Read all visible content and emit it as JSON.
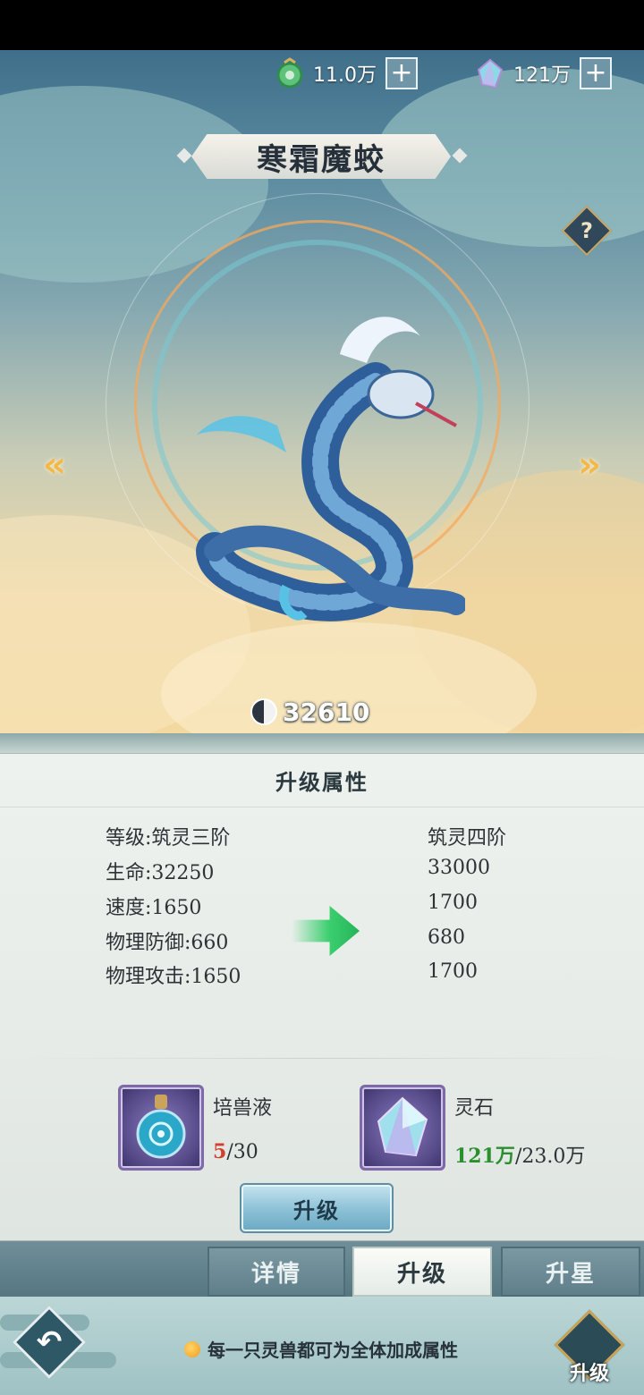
{
  "header": {
    "currencies": [
      {
        "icon": "jade-coin-icon",
        "value": "11.0万"
      },
      {
        "icon": "spirit-crystal-icon",
        "value": "121万"
      }
    ],
    "beast_name": "寒霜魔蛟",
    "help": "?",
    "nav_prev": "«",
    "nav_next": "»",
    "power": "32610"
  },
  "panel": {
    "title": "升级属性",
    "stats": [
      {
        "current": "等级:筑灵三阶",
        "next": "筑灵四阶"
      },
      {
        "current": "生命:32250",
        "next": "33000"
      },
      {
        "current": "速度:1650",
        "next": "1700"
      },
      {
        "current": "物理防御:660",
        "next": "680"
      },
      {
        "current": "物理攻击:1650",
        "next": "1700"
      }
    ],
    "materials": [
      {
        "name": "培兽液",
        "have": "5",
        "need": "/30",
        "icon": "potion-bottle-icon"
      },
      {
        "name": "灵石",
        "have": "121万",
        "need": "/23.0万",
        "icon": "spirit-stone-icon"
      }
    ],
    "upgrade_button": "升级"
  },
  "tabs": [
    {
      "label": "详情",
      "active": false
    },
    {
      "label": "升级",
      "active": true
    },
    {
      "label": "升星",
      "active": false
    }
  ],
  "footer": {
    "tip": "每一只灵兽都可为全体加成属性",
    "emblem_label": "升级"
  },
  "colors": {
    "accent_gold": "#f2b84b",
    "need_red": "#d23f2f",
    "have_green": "#2b8f2e",
    "arrow_green": "#3ccf6f"
  }
}
